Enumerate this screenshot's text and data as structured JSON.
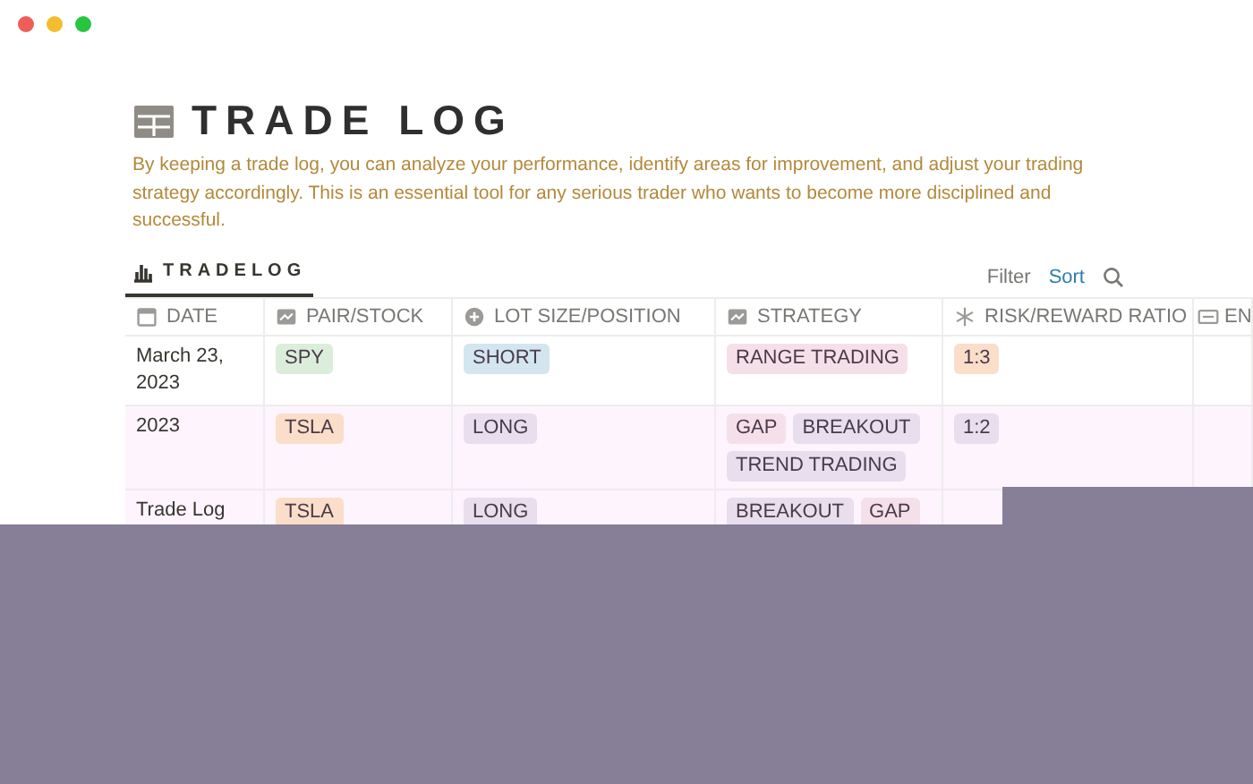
{
  "title": "TRADE LOG",
  "description": "By keeping a trade log, you can analyze your performance, identify areas for improvement, and adjust your trading strategy accordingly. This is an essential tool for any serious trader who wants to become more disciplined and successful.",
  "view_tab": {
    "label": "TRADELOG",
    "selected": true
  },
  "toolbar": {
    "filter": "Filter",
    "sort": "Sort"
  },
  "table": {
    "columns": [
      {
        "label": "DATE",
        "kind": "date"
      },
      {
        "label": "PAIR/STOCK",
        "kind": "select"
      },
      {
        "label": "LOT SIZE/POSITION",
        "kind": "plus"
      },
      {
        "label": "STRATEGY",
        "kind": "select"
      },
      {
        "label": "RISK/REWARD RATIO",
        "kind": "formula"
      },
      {
        "label": "EN",
        "kind": "text"
      }
    ],
    "rows": [
      {
        "date": "March 23, 2023",
        "pair": [
          {
            "label": "SPY",
            "color": "#dbeddb"
          }
        ],
        "position": [
          {
            "label": "SHORT",
            "color": "#d3e5ef"
          }
        ],
        "strategy": [
          {
            "label": "RANGE TRADING",
            "color": "#f5e0e9"
          }
        ],
        "ratio": [
          {
            "label": "1:3",
            "color": "#fadec9"
          }
        ]
      },
      {
        "date": "2023",
        "pair": [
          {
            "label": "TSLA",
            "color": "#fadec9"
          }
        ],
        "position": [
          {
            "label": "LONG",
            "color": "#e8deee"
          }
        ],
        "strategy": [
          {
            "label": "GAP",
            "color": "#f5e0e9"
          },
          {
            "label": "BREAKOUT",
            "color": "#e8deee"
          },
          {
            "label": "TREND TRADING",
            "color": "#e8deee"
          }
        ],
        "ratio": [
          {
            "label": "1:2",
            "color": "#e8deee"
          }
        ]
      },
      {
        "date": "Trade Log",
        "pair": [
          {
            "label": "TSLA",
            "color": "#fadec9"
          }
        ],
        "position": [
          {
            "label": "LONG",
            "color": "#e8deee"
          }
        ],
        "strategy": [
          {
            "label": "BREAKOUT",
            "color": "#e8deee"
          },
          {
            "label": "GAP",
            "color": "#f5e0e9"
          }
        ],
        "ratio": []
      }
    ]
  }
}
